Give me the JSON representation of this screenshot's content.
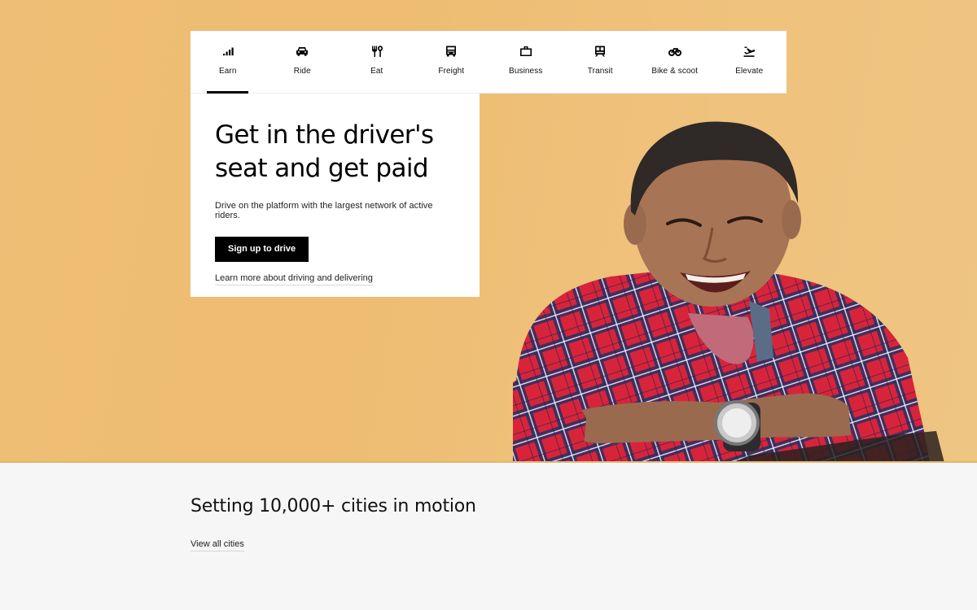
{
  "colors": {
    "hero_bg": "#efbe76",
    "page_bg": "#f6f6f6",
    "primary": "#000000",
    "surface": "#ffffff"
  },
  "tabs": [
    {
      "label": "Earn",
      "icon": "signal-bars-icon",
      "active": true
    },
    {
      "label": "Ride",
      "icon": "car-icon",
      "active": false
    },
    {
      "label": "Eat",
      "icon": "fork-knife-icon",
      "active": false
    },
    {
      "label": "Freight",
      "icon": "truck-icon",
      "active": false
    },
    {
      "label": "Business",
      "icon": "briefcase-icon",
      "active": false
    },
    {
      "label": "Transit",
      "icon": "train-icon",
      "active": false
    },
    {
      "label": "Bike & scoot",
      "icon": "bicycle-icon",
      "active": false
    },
    {
      "label": "Elevate",
      "icon": "airplane-takeoff-icon",
      "active": false
    }
  ],
  "hero": {
    "title": "Get in the driver's seat and get paid",
    "subtitle": "Drive on the platform with the largest network of active riders.",
    "cta_label": "Sign up to drive",
    "link_label": "Learn more about driving and delivering",
    "image_alt": "Smiling driver in red plaid shirt leaning on a car"
  },
  "cities": {
    "title": "Setting 10,000+ cities in motion",
    "link_label": "View all cities"
  }
}
